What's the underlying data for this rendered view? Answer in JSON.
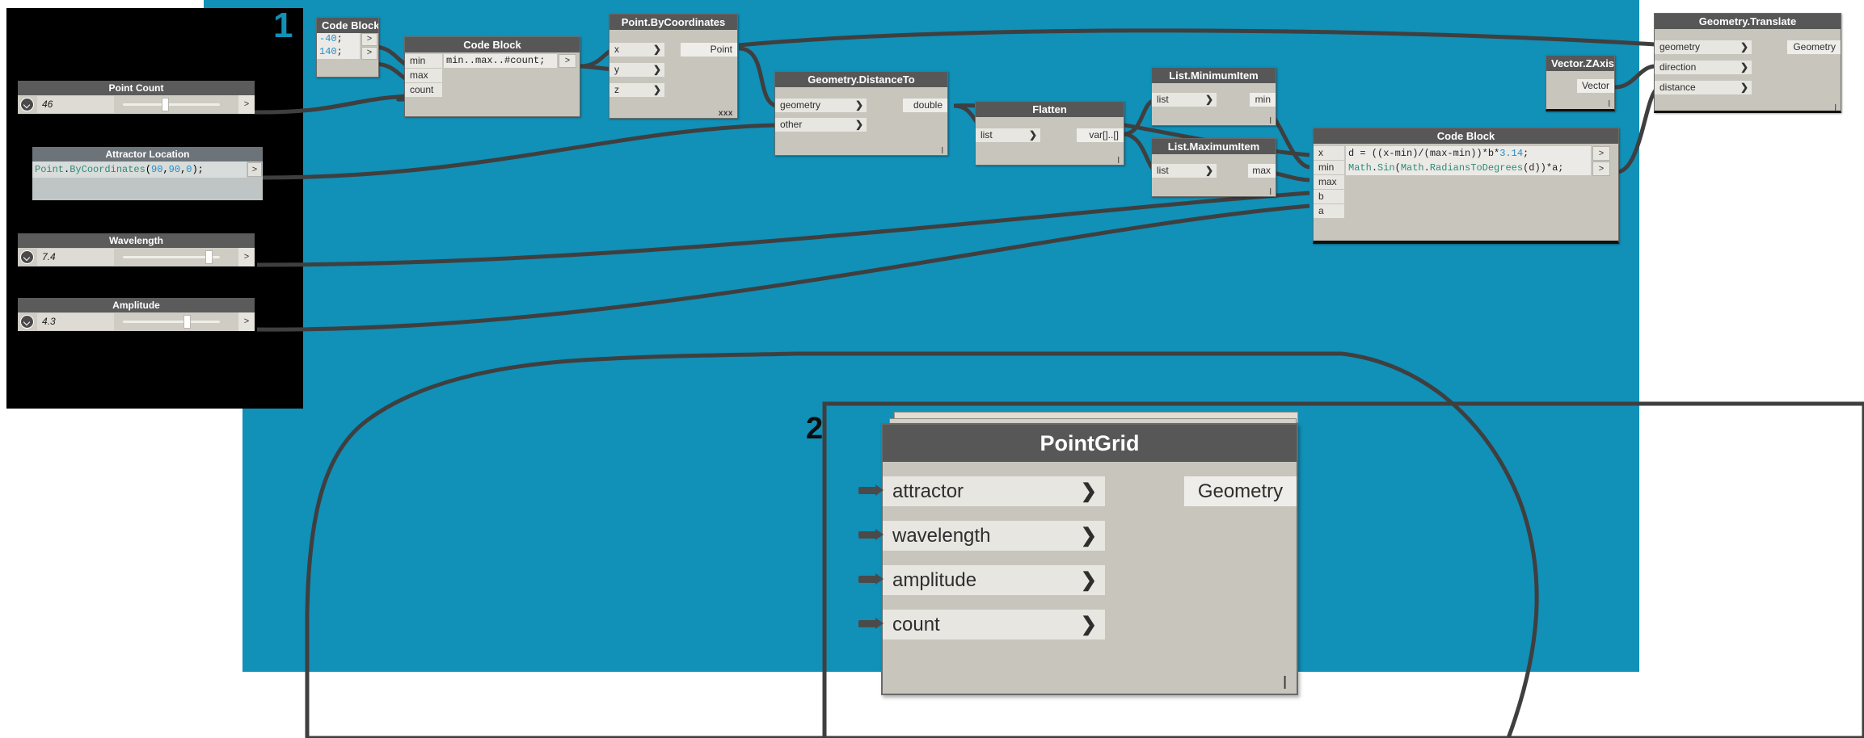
{
  "canvas": {
    "background_color": "#1190b8",
    "white_color": "#ffffff",
    "panel_color": "#000000",
    "node_body_color": "#c8c5bd",
    "node_header_color": "#575757",
    "wire_color": "#3f3f3f"
  },
  "markers": [
    {
      "label": "1"
    },
    {
      "label": "2"
    }
  ],
  "inputs_panel": {
    "point_count": {
      "title": "Point Count",
      "value": "46",
      "out_label": ">",
      "thumb_percent": 36
    },
    "attractor_location": {
      "title": "Attractor Location",
      "code_prefix": "Point",
      "code_dot": ".",
      "code_method": "ByCoordinates",
      "code_full": "Point.ByCoordinates(90,90,0);",
      "args": [
        "90",
        "90",
        "0"
      ],
      "out_label": ">"
    },
    "wavelength": {
      "title": "Wavelength",
      "value": "7.4",
      "out_label": ">",
      "thumb_percent": 91
    },
    "amplitude": {
      "title": "Amplitude",
      "value": "4.3",
      "out_label": ">",
      "thumb_percent": 63
    }
  },
  "nodes": {
    "code_block_minmax": {
      "title": "Code Block",
      "line1": "-40;",
      "line2": "140;",
      "line1_value": "-40",
      "line2_value": "140",
      "out1": ">",
      "out2": ">"
    },
    "code_block_range": {
      "title": "Code Block",
      "inputs": [
        "min",
        "max",
        "count"
      ],
      "code": "min..max..#count;",
      "out": ">"
    },
    "point_by_coordinates": {
      "title": "Point.ByCoordinates",
      "inputs": [
        "x",
        "y",
        "z"
      ],
      "output": "Point",
      "lacing": "xxx"
    },
    "geometry_distance_to": {
      "title": "Geometry.DistanceTo",
      "inputs": [
        "geometry",
        "other"
      ],
      "output": "double",
      "lacing": "l"
    },
    "flatten": {
      "title": "Flatten",
      "inputs": [
        "list"
      ],
      "output": "var[]..[]",
      "lacing": "l"
    },
    "list_minimum_item": {
      "title": "List.MinimumItem",
      "inputs": [
        "list"
      ],
      "output": "min",
      "lacing": "l"
    },
    "list_maximum_item": {
      "title": "List.MaximumItem",
      "inputs": [
        "list"
      ],
      "output": "max",
      "lacing": "l"
    },
    "code_block_formula": {
      "title": "Code Block",
      "inputs": [
        "x",
        "min",
        "max",
        "b",
        "a"
      ],
      "line1": "d = ((x-min)/(max-min))*b*3.14;",
      "line1_plain": "d = ((x-min)/(max-min))*b*",
      "line1_num": "3.14",
      "line1_end": ";",
      "line2": "Math.Sin(Math.RadiansToDegrees(d))*a;",
      "out1": ">",
      "out2": ">"
    },
    "vector_zaxis": {
      "title": "Vector.ZAxis",
      "output": "Vector",
      "lacing": "l"
    },
    "geometry_translate": {
      "title": "Geometry.Translate",
      "inputs": [
        "geometry",
        "direction",
        "distance"
      ],
      "output": "Geometry",
      "lacing": "l"
    },
    "point_grid": {
      "title": "PointGrid",
      "inputs": [
        "attractor",
        "wavelength",
        "amplitude",
        "count"
      ],
      "output": "Geometry",
      "lacing": "l"
    }
  }
}
